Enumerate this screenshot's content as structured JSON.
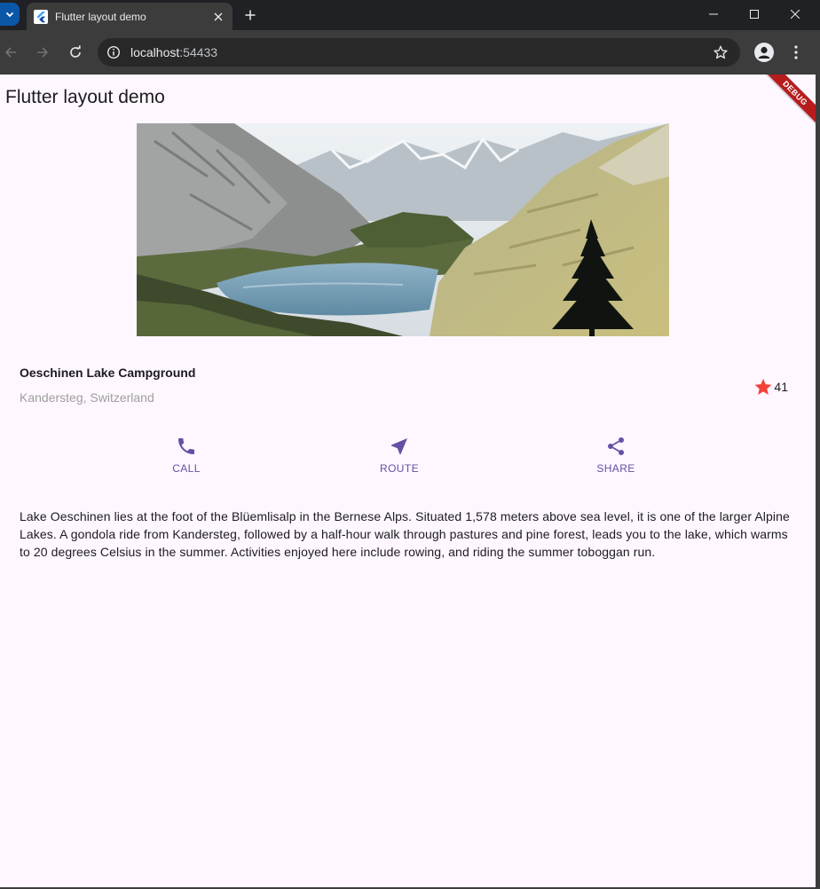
{
  "browser": {
    "tab_title": "Flutter layout demo",
    "url_host": "localhost",
    "url_port": ":54433"
  },
  "app": {
    "title": "Flutter layout demo",
    "debug_banner": "DEBUG"
  },
  "title_section": {
    "name": "Oeschinen Lake Campground",
    "location": "Kandersteg, Switzerland",
    "rating_icon": "star-icon",
    "rating_count": "41",
    "rating_color": "#f44336"
  },
  "actions": [
    {
      "icon": "phone-icon",
      "label": "CALL"
    },
    {
      "icon": "near-me-icon",
      "label": "ROUTE"
    },
    {
      "icon": "share-icon",
      "label": "SHARE"
    }
  ],
  "accent_color": "#6750a4",
  "description": "Lake Oeschinen lies at the foot of the Blüemlisalp in the Bernese Alps. Situated 1,578 meters above sea level, it is one of the larger Alpine Lakes. A gondola ride from Kandersteg, followed by a half-hour walk through pastures and pine forest, leads you to the lake, which warms to 20 degrees Celsius in the summer. Activities enjoyed here include rowing, and riding the summer toboggan run."
}
